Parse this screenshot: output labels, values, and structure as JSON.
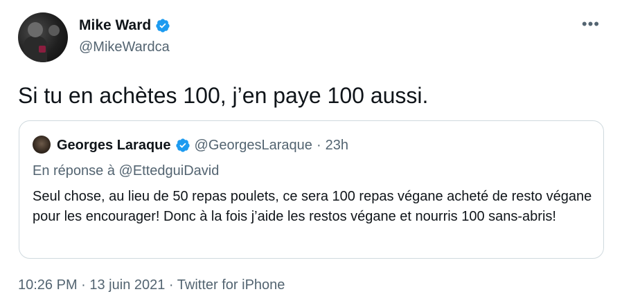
{
  "author": {
    "name": "Mike Ward",
    "handle": "@MikeWardca"
  },
  "more_label": "•••",
  "tweet_text": "Si tu en achètes 100, j’en paye 100 aussi.",
  "quoted": {
    "name": "Georges Laraque",
    "handle": "@GeorgesLaraque",
    "separator": "·",
    "time": "23h",
    "reply_line": "En réponse à @EttedguiDavid",
    "body": "Seul chose, au lieu de 50 repas poulets, ce sera 100 repas végane acheté de resto végane pour les encourager! Donc à la fois j’aide les restos végane et nourris 100 sans-abris!"
  },
  "footer_meta": "10:26 PM · 13 juin 2021 · Twitter for iPhone",
  "colors": {
    "verified_blue": "#1d9bf0",
    "secondary_text": "#536471",
    "border": "#cfd9de"
  }
}
